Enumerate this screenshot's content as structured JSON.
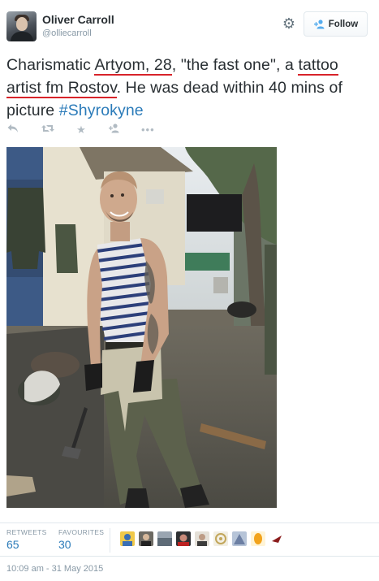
{
  "user": {
    "name": "Oliver Carroll",
    "handle": "@olliecarroll"
  },
  "follow_label": "Follow",
  "tweet": {
    "part1": "Charismatic ",
    "hl1": "Artyom, 28",
    "part2": ", \"the fast one\", a ",
    "hl2": "tattoo artist fm Rostov",
    "part3": ". He was dead within 40 mins of picture ",
    "hashtag": "#Shyrokyne"
  },
  "stats": {
    "retweets_label": "RETWEETS",
    "retweets": "65",
    "favourites_label": "FAVOURITES",
    "favourites": "30"
  },
  "timestamp": "10:09 am - 31 May 2015",
  "colors": {
    "link": "#2b7bb9",
    "underline": "#d8232a",
    "muted": "#8899a6"
  },
  "icons": {
    "gear": "gear-icon",
    "follow": "add-user-icon",
    "reply": "reply-icon",
    "retweet": "retweet-icon",
    "favorite": "star-icon",
    "follow_action": "add-user-icon",
    "more": "more-icon"
  }
}
